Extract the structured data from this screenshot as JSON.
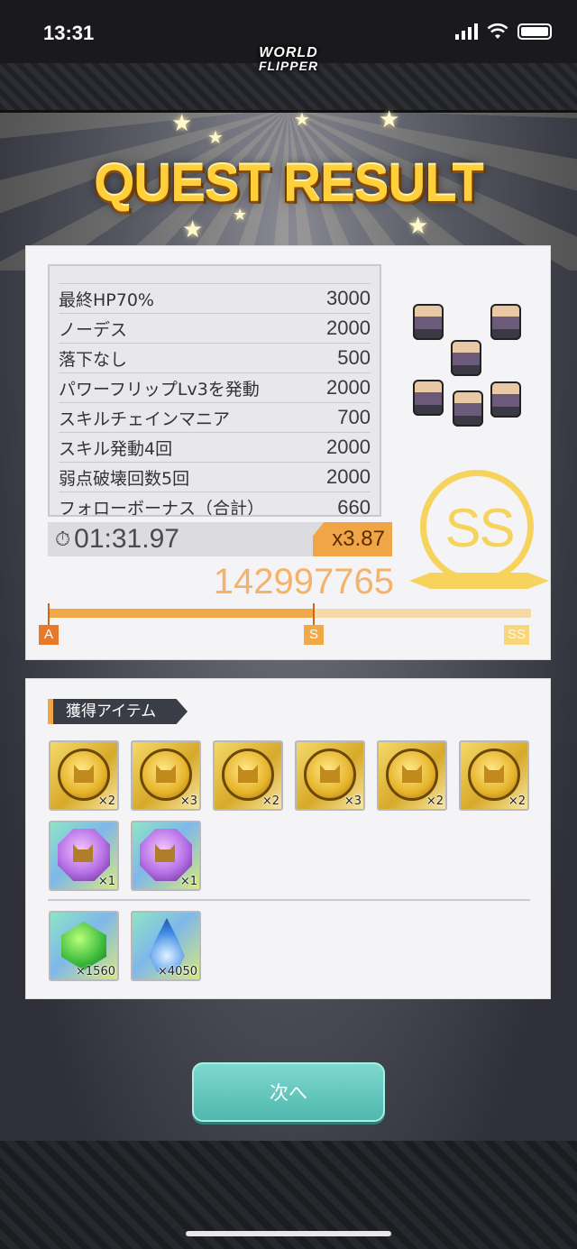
{
  "status_bar": {
    "time": "13:31"
  },
  "logo": {
    "line1": "WORLD",
    "line2": "FLIPPER"
  },
  "quest_title": "QUEST RESULT",
  "score_table": {
    "rows": [
      {
        "label": "最終HP70%",
        "value": "3000"
      },
      {
        "label": "ノーデス",
        "value": "2000"
      },
      {
        "label": "落下なし",
        "value": "500"
      },
      {
        "label": "パワーフリップLv3を発動",
        "value": "2000"
      },
      {
        "label": "スキルチェインマニア",
        "value": "700"
      },
      {
        "label": "スキル発動4回",
        "value": "2000"
      },
      {
        "label": "弱点破壊回数5回",
        "value": "2000"
      },
      {
        "label": "フォローボーナス（合計）",
        "value": "660"
      }
    ]
  },
  "timer": {
    "icon": "stopwatch-icon",
    "value": "01:31.97"
  },
  "multiplier": "x3.87",
  "total_score": "142997765",
  "rank": {
    "progress_fraction": 0.55,
    "marks": {
      "a": "A",
      "s": "S",
      "ss": "SS"
    },
    "badge": "SS"
  },
  "items_section": {
    "heading": "獲得アイテム",
    "items": [
      {
        "type": "gold-coin",
        "count": "×2"
      },
      {
        "type": "gold-coin",
        "count": "×3"
      },
      {
        "type": "gold-coin",
        "count": "×2"
      },
      {
        "type": "gold-coin",
        "count": "×3"
      },
      {
        "type": "gold-coin",
        "count": "×2"
      },
      {
        "type": "gold-coin",
        "count": "×2"
      },
      {
        "type": "purple-crest",
        "count": "×1"
      },
      {
        "type": "purple-crest",
        "count": "×1"
      }
    ],
    "rewards": [
      {
        "type": "green-gem",
        "count": "×1560"
      },
      {
        "type": "blue-flame",
        "count": "×4050"
      }
    ]
  },
  "next_button": "次へ",
  "colors": {
    "accent_orange": "#f1a947",
    "button_teal": "#5fc7bd",
    "title_gold": "#ffd03a"
  }
}
